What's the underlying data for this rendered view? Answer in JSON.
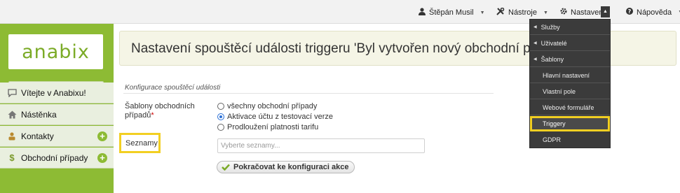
{
  "topbar": {
    "user": "Štěpán Musil",
    "tools": "Nástroje",
    "settings": "Nastavení",
    "help": "Nápověda"
  },
  "sidebar": {
    "logo": "anabix",
    "search_value": "",
    "items": [
      {
        "label": "Vítejte v Anabixu!",
        "icon": "chat-icon",
        "has_plus": false
      },
      {
        "label": "Nástěnka",
        "icon": "home-icon",
        "has_plus": false
      },
      {
        "label": "Kontakty",
        "icon": "contacts-icon",
        "has_plus": true
      },
      {
        "label": "Obchodní případy",
        "icon": "dollar-icon",
        "has_plus": true
      }
    ]
  },
  "header": {
    "title": "Nastavení spouštěcí události triggeru 'Byl vytvořen nový obchodní případ'"
  },
  "form": {
    "legend": "Konfigurace spouštěcí události",
    "templates_label_line1": "Šablony obchodních",
    "templates_label_line2": "případů",
    "required_mark": "*",
    "radios": [
      {
        "label": "všechny obchodní případy",
        "checked": false
      },
      {
        "label": "Aktivace účtu z testovací verze",
        "checked": true
      },
      {
        "label": "Prodloužení platnosti tarifu",
        "checked": false
      }
    ],
    "lists_label": "Seznamy",
    "lists_placeholder": "Vyberte seznamy...",
    "continue_label": "Pokračovat ke konfiguraci akce"
  },
  "dropdown": {
    "items": [
      {
        "label": "Služby",
        "submenu": true
      },
      {
        "label": "Uživatelé",
        "submenu": true
      },
      {
        "label": "Šablony",
        "submenu": true
      },
      {
        "label": "Hlavní nastavení",
        "submenu": false
      },
      {
        "label": "Vlastní pole",
        "submenu": false
      },
      {
        "label": "Webové formuláře",
        "submenu": false
      },
      {
        "label": "Triggery",
        "submenu": false,
        "active": true
      },
      {
        "label": "GDPR",
        "submenu": false
      }
    ]
  },
  "colors": {
    "brand_green": "#8dbb34",
    "highlight_yellow": "#f2cf22",
    "dropdown_bg": "#3b3b3b"
  }
}
